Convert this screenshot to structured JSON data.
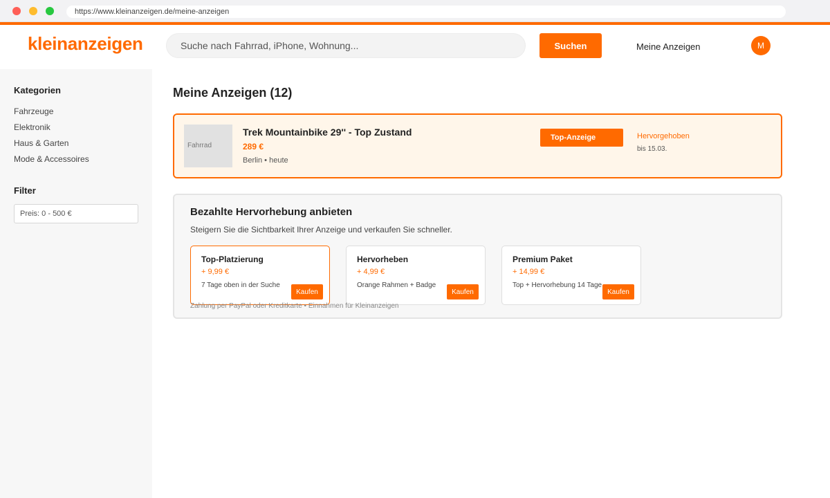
{
  "browser": {
    "url": "https://www.kleinanzeigen.de/meine-anzeigen"
  },
  "header": {
    "logo": "kleinanzeigen",
    "search_placeholder": "Suche nach Fahrrad, iPhone, Wohnung...",
    "search_button": "Suchen",
    "nav_link": "Meine Anzeigen",
    "avatar_initial": "M"
  },
  "sidebar": {
    "categories_heading": "Kategorien",
    "categories": [
      "Fahrzeuge",
      "Elektronik",
      "Haus & Garten",
      "Mode & Accessoires"
    ],
    "filter_heading": "Filter",
    "price_filter": "Preis: 0 - 500 €"
  },
  "main": {
    "title": "Meine Anzeigen (12)",
    "listing": {
      "thumb_label": "Fahrrad",
      "title": "Trek Mountainbike 29'' - Top Zustand",
      "price": "289 €",
      "meta": "Berlin • heute",
      "badge": "Top-Anzeige",
      "status": "Hervorgehoben",
      "status_until": "bis 15.03."
    },
    "promo": {
      "title": "Bezahlte Hervorhebung anbieten",
      "subtitle": "Steigern Sie die Sichtbarkeit Ihrer Anzeige und verkaufen Sie schneller.",
      "offers": [
        {
          "name": "Top-Platzierung",
          "price": "+ 9,99 €",
          "desc": "7 Tage oben in der Suche",
          "button": "Kaufen"
        },
        {
          "name": "Hervorheben",
          "price": "+ 4,99 €",
          "desc": "Orange Rahmen + Badge",
          "button": "Kaufen"
        },
        {
          "name": "Premium Paket",
          "price": "+ 14,99 €",
          "desc": "Top + Hervorhebung 14 Tage",
          "button": "Kaufen"
        }
      ],
      "footer": "Zahlung per PayPal oder Kreditkarte • Einnahmen für Kleinanzeigen"
    }
  },
  "colors": {
    "accent": "#ff6a00",
    "listing_bg": "#fff6ea"
  }
}
